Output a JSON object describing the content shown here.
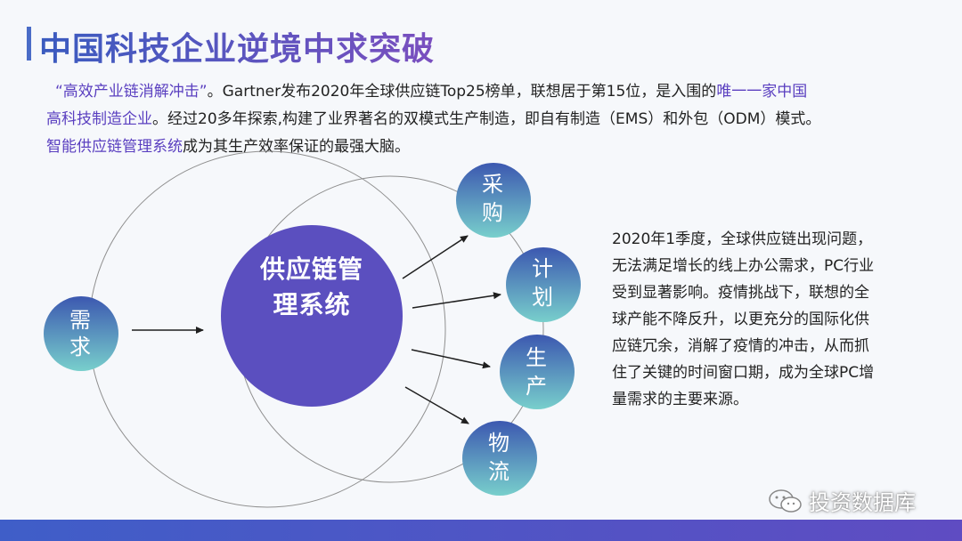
{
  "title": "中国科技企业逆境中求突破",
  "intro": {
    "line1_hl": "“高效产业链消解冲击”",
    "line1_rest": "。Gartner发布2020年全球供应链Top25榜单，联想居于第15位，是入围的",
    "line1_hl2": "唯一一家中国",
    "line2_hl": "高科技制造企业",
    "line2_rest": "。经过20多年探索,构建了业界著名的双模式生产制造，即自有制造（EMS）和外包（ODM）模式。",
    "line3_hl": "智能供应链管理系统",
    "line3_rest": "成为其生产效率保证的最强大脑。"
  },
  "diagram": {
    "demand": [
      "需",
      "求"
    ],
    "center": [
      "供应链管",
      "理系统"
    ],
    "outputs": {
      "procure": [
        "采",
        "购"
      ],
      "plan": [
        "计",
        "划"
      ],
      "produce": [
        "生",
        "产"
      ],
      "logistics": [
        "物",
        "流"
      ]
    }
  },
  "side_text": "2020年1季度，全球供应链出现问题，无法满足增长的线上办公需求，PC行业受到显著影响。疫情挑战下，联想的全球产能不降反升，以更充分的国际化供应链冗余，消解了疫情的冲击，从而抓住了关键的时间窗口期，成为全球PC增量需求的主要来源。",
  "watermark": "投资数据库",
  "colors": {
    "title": "#4c5fc1",
    "highlight": "#5a3fc0",
    "center_circle": "#5b4fbf",
    "small_circle_top": "#3c5bb0",
    "small_circle_bottom": "#72c7c8"
  }
}
